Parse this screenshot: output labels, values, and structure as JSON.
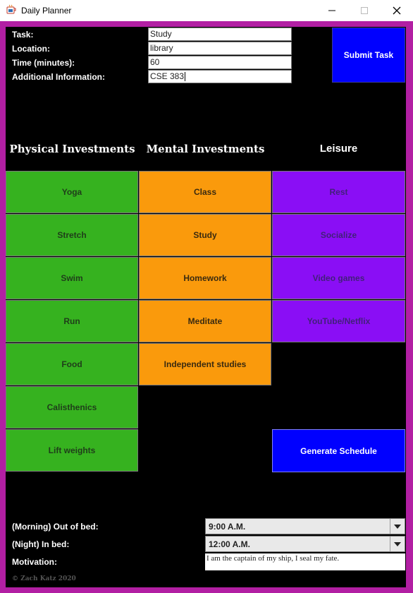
{
  "window": {
    "title": "Daily Planner"
  },
  "form": {
    "task_label": "Task:",
    "task_value": "Study",
    "location_label": "Location:",
    "location_value": "library",
    "time_label": "Time (minutes):",
    "time_value": "60",
    "info_label": "Additional Information:",
    "info_value": "CSE 383",
    "submit_label": "Submit Task"
  },
  "categories": {
    "physical": {
      "title": "Physical Investments",
      "items": [
        "Yoga",
        "Stretch",
        "Swim",
        "Run",
        "Food",
        "Calisthenics",
        "Lift weights"
      ]
    },
    "mental": {
      "title": "Mental Investments",
      "items": [
        "Class",
        "Study",
        "Homework",
        "Meditate",
        "Independent studies"
      ]
    },
    "leisure": {
      "title": "Leisure",
      "items": [
        "Rest",
        "Socialize",
        "Video games",
        "YouTube/Netflix"
      ]
    }
  },
  "generate_label": "Generate Schedule",
  "schedule": {
    "morning_label": "(Morning) Out of bed:",
    "morning_value": "9:00 A.M.",
    "night_label": "(Night) In bed:",
    "night_value": "12:00 A.M.",
    "motivation_label": "Motivation:",
    "motivation_value": "I am the captain of my ship, I seal my fate."
  },
  "footer": {
    "copyright": "© Zach Katz 2020"
  },
  "colors": {
    "frame": "#b21fa3",
    "background": "#000000",
    "physical": "#36b21f",
    "mental": "#fa9a0c",
    "leisure": "#8a0ef5",
    "button": "#0000ff"
  }
}
